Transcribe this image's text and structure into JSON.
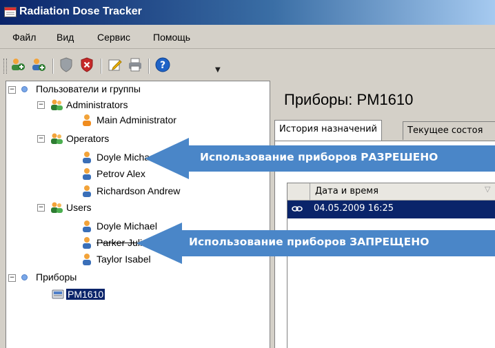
{
  "window": {
    "title": "Radiation Dose Tracker"
  },
  "menu": [
    "Файл",
    "Вид",
    "Сервис",
    "Помощь"
  ],
  "toolbar": {
    "buttons": [
      "add-user-icon",
      "add-group-icon",
      "shield-icon",
      "shield-delete-icon",
      "edit-icon",
      "print-icon",
      "help-icon"
    ]
  },
  "tree": {
    "root_users": "Пользователи и группы",
    "group_admins": "Administrators",
    "admin_1": "Main Administrator",
    "group_operators": "Operators",
    "op_1": "Doyle Michael",
    "op_2": "Petrov Alex",
    "op_3": "Richardson Andrew",
    "group_users": "Users",
    "user_1": "Doyle Michael",
    "user_2": "Parker Julia",
    "user_3": "Taylor Isabel",
    "root_devices": "Приборы",
    "device_1": "PM1610",
    "expander": "−"
  },
  "detail": {
    "heading": "Приборы: PM1610",
    "tabs": [
      "История назначений",
      "Текущее состоя"
    ],
    "grid": {
      "column": "Дата и время",
      "rows": [
        {
          "datetime": "04.05.2009 16:25"
        }
      ]
    }
  },
  "annotations": {
    "allowed": "Использование приборов РАЗРЕШЕНО",
    "denied": "Использование приборов ЗАПРЕЩЕНО"
  },
  "colors": {
    "selection": "#0a246a",
    "arrow": "#4a86c8",
    "titlebar": "#0a246a"
  }
}
